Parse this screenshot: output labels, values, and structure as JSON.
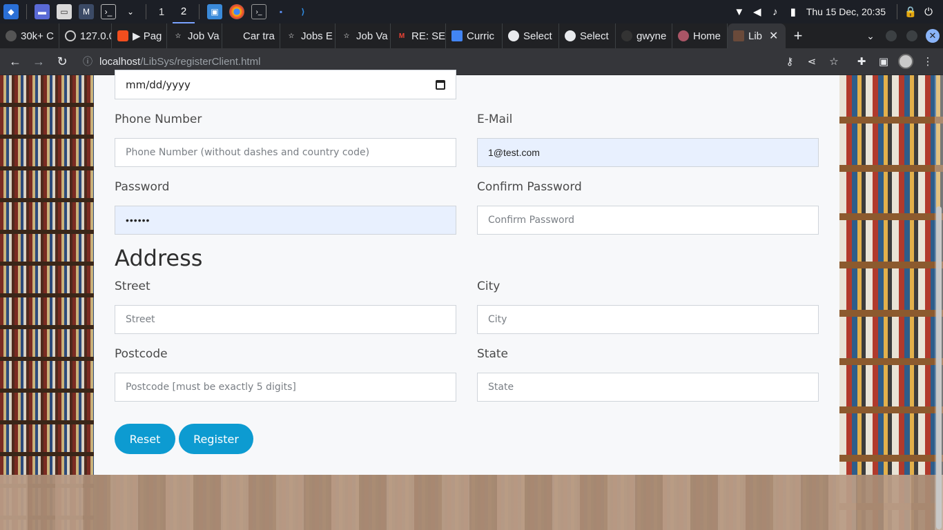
{
  "os": {
    "workspaces": [
      "1",
      "2"
    ],
    "active_workspace": "2",
    "clock": "Thu 15 Dec, 20:35"
  },
  "browser": {
    "tabs": [
      {
        "label": "30k+ C",
        "icon": "site-icon"
      },
      {
        "label": "127.0.0",
        "icon": "globe-icon"
      },
      {
        "label": "▶ Pag",
        "icon": "figma-icon"
      },
      {
        "label": "Job Va",
        "icon": "star-icon"
      },
      {
        "label": "Car tra",
        "icon": "blank-icon"
      },
      {
        "label": "Jobs E",
        "icon": "star-icon"
      },
      {
        "label": "Job Va",
        "icon": "star-icon"
      },
      {
        "label": "RE: SE",
        "icon": "gmail-icon"
      },
      {
        "label": "Curric",
        "icon": "docs-icon"
      },
      {
        "label": "Select",
        "icon": "globe-icon"
      },
      {
        "label": "Select",
        "icon": "globe-icon"
      },
      {
        "label": "gwyne",
        "icon": "github-icon"
      },
      {
        "label": "Home",
        "icon": "site-icon"
      },
      {
        "label": "Lib",
        "icon": "library-icon"
      }
    ],
    "address": {
      "host": "localhost",
      "path": "/LibSys/registerClient.html"
    }
  },
  "form": {
    "date_value": "mm/dd/yyyy",
    "phone": {
      "label": "Phone Number",
      "placeholder": "Phone Number (without dashes and country code)",
      "value": ""
    },
    "email": {
      "label": "E-Mail",
      "value": "1@test.com"
    },
    "password": {
      "label": "Password",
      "value": "••••••"
    },
    "confirm_password": {
      "label": "Confirm Password",
      "placeholder": "Confirm Password"
    },
    "address_title": "Address",
    "street": {
      "label": "Street",
      "placeholder": "Street"
    },
    "city": {
      "label": "City",
      "placeholder": "City"
    },
    "postcode": {
      "label": "Postcode",
      "placeholder": "Postcode [must be exactly 5 digits]"
    },
    "state": {
      "label": "State",
      "placeholder": "State"
    },
    "reset_label": "Reset",
    "register_label": "Register"
  },
  "colors": {
    "button": "#0d9bd1",
    "autofill": "#e8f0fe",
    "card": "#f7f8fa"
  }
}
